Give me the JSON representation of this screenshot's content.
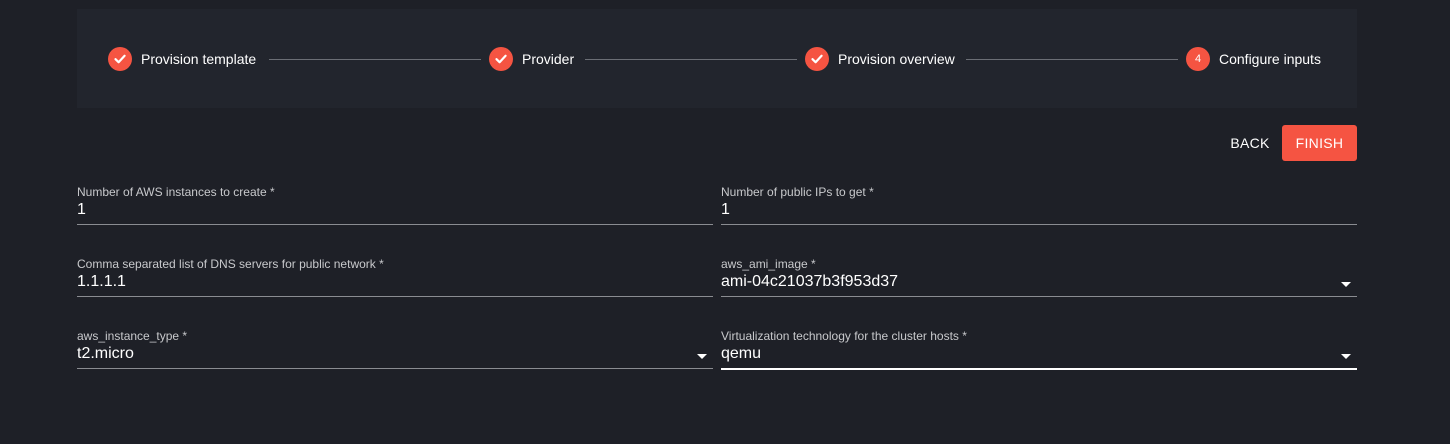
{
  "stepper": {
    "steps": [
      {
        "label": "Provision template",
        "state": "completed",
        "icon": "check-icon"
      },
      {
        "label": "Provider",
        "state": "completed",
        "icon": "check-icon"
      },
      {
        "label": "Provision overview",
        "state": "completed",
        "icon": "check-icon"
      },
      {
        "label": "Configure inputs",
        "state": "active",
        "number": "4"
      }
    ]
  },
  "actions": {
    "back_label": "BACK",
    "finish_label": "FINISH"
  },
  "form": {
    "fields": [
      {
        "label": "Number of AWS instances to create *",
        "value": "1",
        "type": "text"
      },
      {
        "label": "Number of public IPs to get *",
        "value": "1",
        "type": "text"
      },
      {
        "label": "Comma separated list of DNS servers for public network *",
        "value": "1.1.1.1",
        "type": "text"
      },
      {
        "label": "aws_ami_image *",
        "value": "ami-04c21037b3f953d37",
        "type": "select",
        "icon": "chevron-down-icon"
      },
      {
        "label": "aws_instance_type *",
        "value": "t2.micro",
        "type": "select",
        "icon": "chevron-down-icon"
      },
      {
        "label": "Virtualization technology for the cluster hosts *",
        "value": "qemu",
        "type": "select",
        "icon": "chevron-down-icon"
      }
    ]
  },
  "colors": {
    "accent": "#f55442",
    "background": "#1e2027",
    "panel": "#22252d"
  }
}
